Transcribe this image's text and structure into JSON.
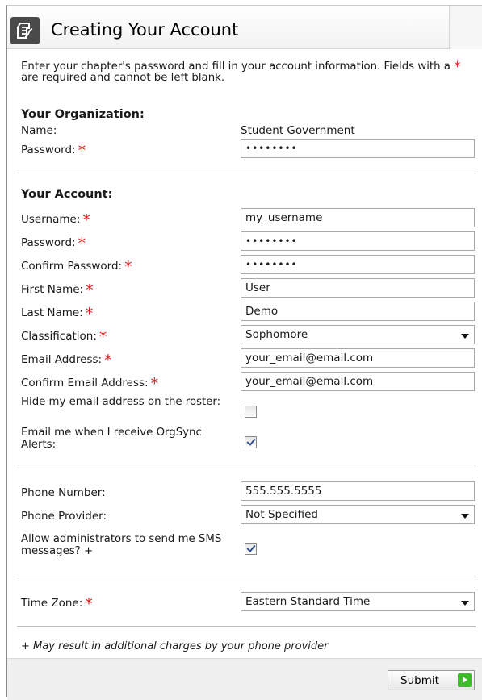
{
  "header": {
    "title": "Creating Your Account",
    "icon": "form-document-icon"
  },
  "intro": {
    "before": "Enter your chapter's password and fill in your account information. Fields with a",
    "after": "are required and cannot be left blank."
  },
  "required_marker": "*",
  "organization": {
    "heading": "Your Organization:",
    "name_label": "Name:",
    "name_value": "Student Government",
    "password_label": "Password:",
    "password_value": "••••••••"
  },
  "account": {
    "heading": "Your Account:",
    "username_label": "Username:",
    "username_value": "my_username",
    "password_label": "Password:",
    "password_value": "••••••••",
    "confirm_password_label": "Confirm Password:",
    "confirm_password_value": "••••••••",
    "first_name_label": "First Name:",
    "first_name_value": "User",
    "last_name_label": "Last Name:",
    "last_name_value": "Demo",
    "classification_label": "Classification:",
    "classification_value": "Sophomore",
    "email_label": "Email Address:",
    "email_value": "your_email@email.com",
    "confirm_email_label": "Confirm Email Address:",
    "confirm_email_value": "your_email@email.com",
    "hide_email_label": "Hide my email address on the roster:",
    "hide_email_checked": false,
    "alerts_label": "Email me when I receive OrgSync Alerts:",
    "alerts_checked": true
  },
  "phone": {
    "number_label": "Phone Number:",
    "number_value": "555.555.5555",
    "provider_label": "Phone Provider:",
    "provider_value": "Not Specified",
    "sms_label": "Allow administrators to send me SMS messages? +",
    "sms_checked": true
  },
  "timezone": {
    "label": "Time Zone:",
    "value": "Eastern Standard Time"
  },
  "footnote": "+ May result in additional charges by your phone provider",
  "footer": {
    "submit_label": "Submit",
    "submit_icon": "arrow-right-icon"
  },
  "colors": {
    "required": "#e11b1b",
    "submit_accent": "#3dbb2a"
  }
}
